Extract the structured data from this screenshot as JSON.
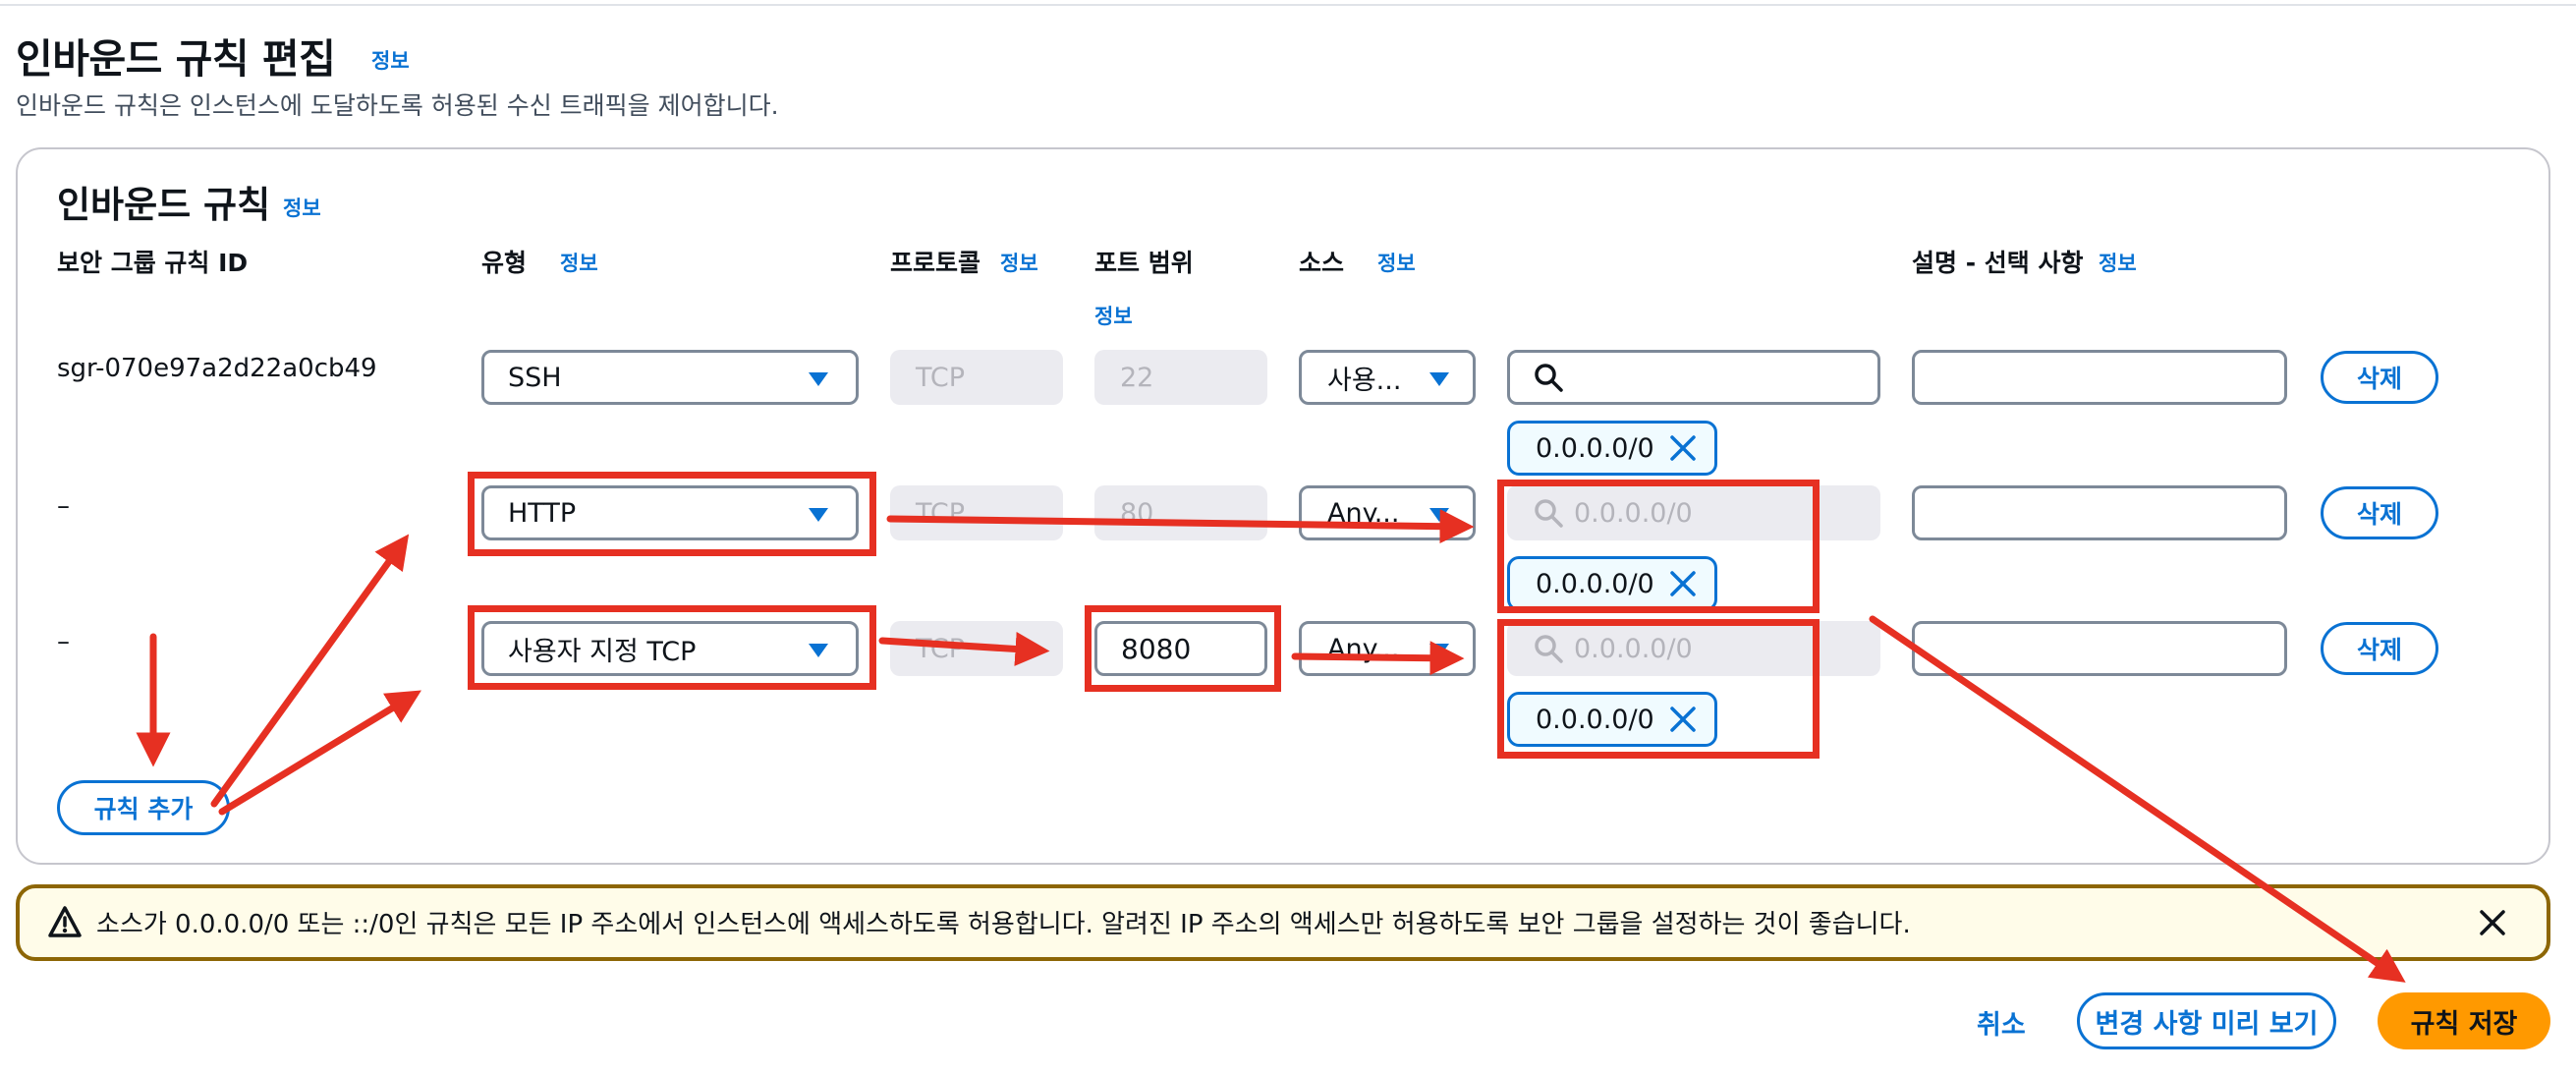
{
  "page": {
    "title": "인바운드 규칙 편집",
    "title_info": "정보",
    "description": "인바운드 규칙은 인스턴스에 도달하도록 허용된 수신 트래픽을 제어합니다."
  },
  "rules_panel": {
    "title": "인바운드 규칙",
    "title_info": "정보",
    "columns": {
      "rule_id": "보안 그룹 규칙 ID",
      "type": "유형",
      "type_info": "정보",
      "protocol": "프로토콜",
      "protocol_info": "정보",
      "port_range": "포트 범위",
      "port_range_info": "정보",
      "source": "소스",
      "source_info": "정보",
      "description": "설명 - 선택 사항",
      "description_info": "정보"
    },
    "rows": [
      {
        "rule_id": "sgr-070e97a2d22a0cb49",
        "type": "SSH",
        "protocol": "TCP",
        "port": "22",
        "source_select": "사용...",
        "source_search_placeholder": "",
        "token": "0.0.0.0/0",
        "description_value": "",
        "delete_label": "삭제"
      },
      {
        "rule_id": "–",
        "type": "HTTP",
        "protocol": "TCP",
        "port": "80",
        "source_select": "Any...",
        "source_search_placeholder": "0.0.0.0/0",
        "token": "0.0.0.0/0",
        "description_value": "",
        "delete_label": "삭제"
      },
      {
        "rule_id": "–",
        "type": "사용자 지정 TCP",
        "protocol": "TCP",
        "port": "8080",
        "source_select": "Any...",
        "source_search_placeholder": "0.0.0.0/0",
        "token": "0.0.0.0/0",
        "description_value": "",
        "delete_label": "삭제"
      }
    ],
    "add_rule_label": "규칙 추가"
  },
  "alert": {
    "text": "소스가 0.0.0.0/0 또는 ::/0인 규칙은 모든 IP 주소에서 인스턴스에 액세스하도록 허용합니다. 알려진 IP 주소의 액세스만 허용하도록 보안 그룹을 설정하는 것이 좋습니다."
  },
  "footer": {
    "cancel_label": "취소",
    "preview_label": "변경 사항 미리 보기",
    "save_label": "규칙 저장"
  },
  "colors": {
    "accent": "#0972d3",
    "primary_button": "#ff9900",
    "annotation": "#e63022",
    "warning_border": "#8d6605",
    "warning_bg": "#fffce9"
  }
}
